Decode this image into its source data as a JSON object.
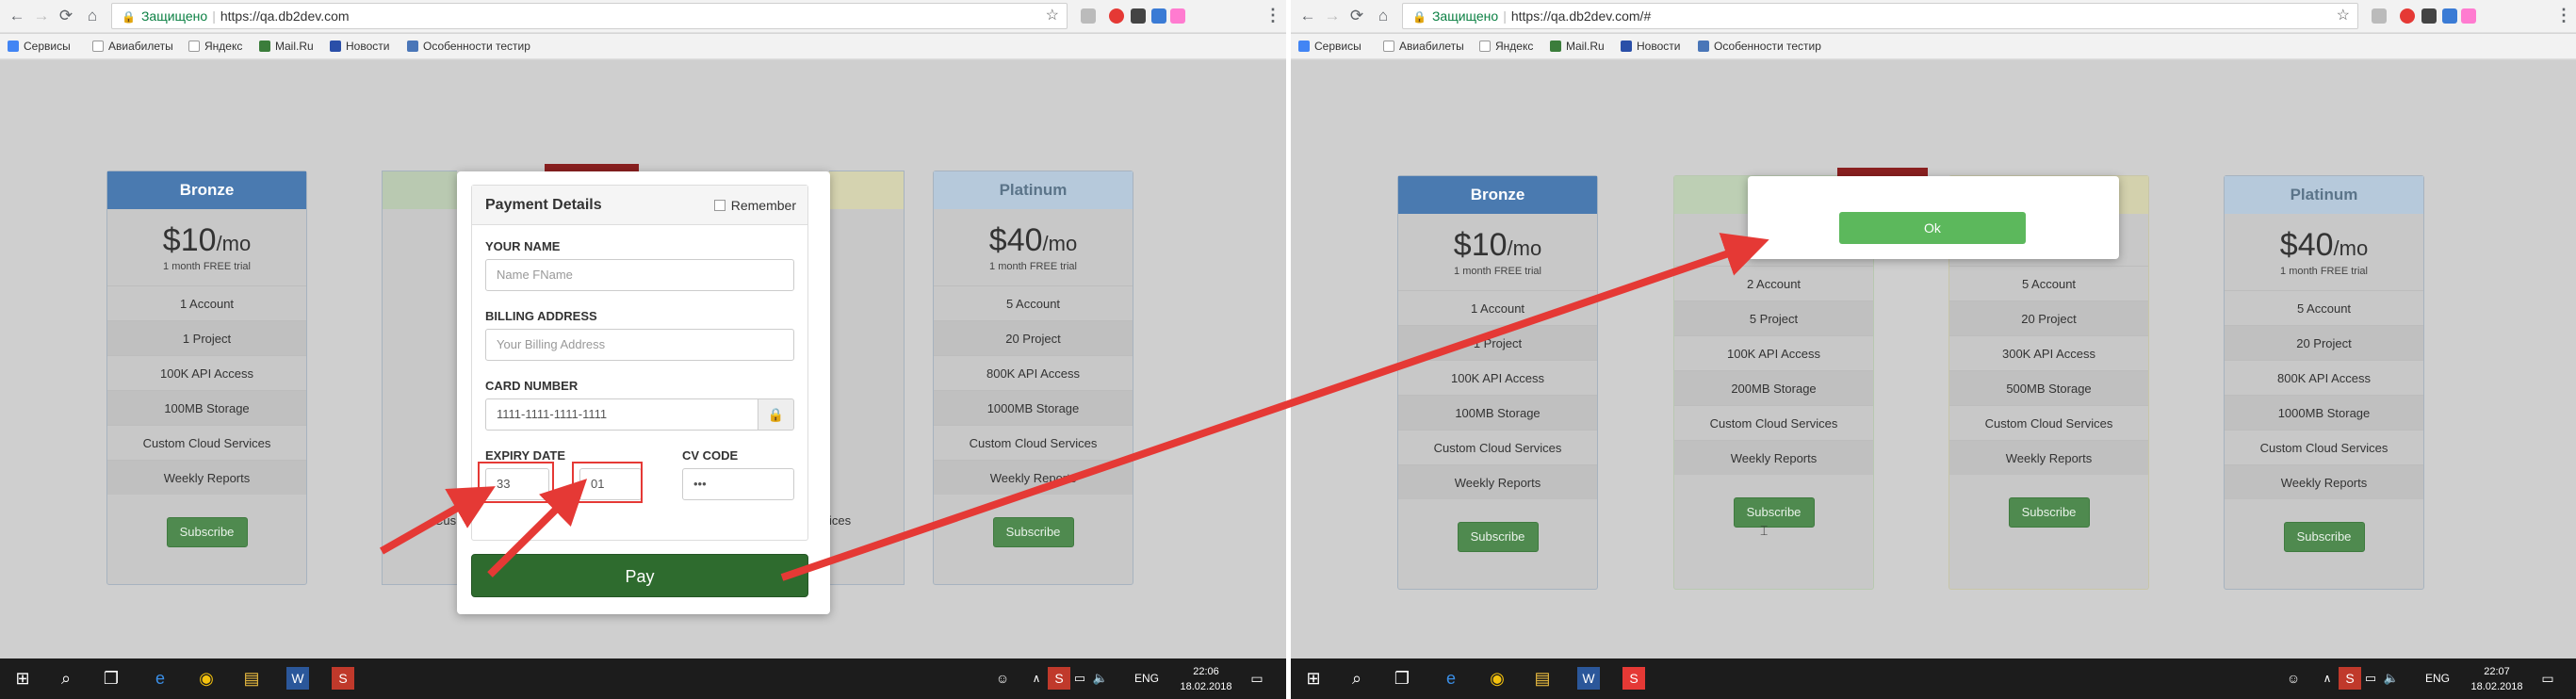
{
  "left": {
    "browser": {
      "secure_label": "Защищено",
      "url": "https://qa.db2dev.com"
    },
    "bookmarks": [
      "Сервисы",
      "Авиабилеты",
      "Яндекс",
      "Mail.Ru",
      "Новости",
      "Особенности тестир"
    ],
    "cards": [
      {
        "name": "Bronze",
        "price": "$10",
        "per": "/mo",
        "trial": "1 month FREE trial",
        "features": [
          "1 Account",
          "1 Project",
          "100K API Access",
          "100MB Storage",
          "Custom Cloud Services",
          "Weekly Reports"
        ],
        "button": "Subscribe"
      },
      {
        "name": "Platinum",
        "price": "$40",
        "per": "/mo",
        "trial": "1 month FREE trial",
        "features": [
          "5 Account",
          "20 Project",
          "800K API Access",
          "1000MB Storage",
          "Custom Cloud Services",
          "Weekly Reports"
        ],
        "button": "Subscribe"
      }
    ],
    "partial_texts": {
      "custom_left": "Cus",
      "custom_right": "ices",
      "weekly_right": "Weekly Reports"
    },
    "modal": {
      "title": "Payment Details",
      "remember": "Remember",
      "name_label": "YOUR NAME",
      "name_placeholder": "Name FName",
      "billing_label": "BILLING ADDRESS",
      "billing_placeholder": "Your Billing Address",
      "card_label": "CARD NUMBER",
      "card_value": "1111-1111-1111-1111",
      "expiry_label": "EXPIRY DATE",
      "expiry_month": "33",
      "expiry_year": "01",
      "cv_label": "CV CODE",
      "cv_value": "•••",
      "pay": "Pay"
    },
    "taskbar": {
      "lang": "ENG",
      "time": "22:06",
      "date": "18.02.2018"
    }
  },
  "right": {
    "browser": {
      "secure_label": "Защищено",
      "url": "https://qa.db2dev.com/#"
    },
    "bookmarks": [
      "Сервисы",
      "Авиабилеты",
      "Яндекс",
      "Mail.Ru",
      "Новости",
      "Особенности тестир"
    ],
    "cards": [
      {
        "name": "Bronze",
        "price": "$10",
        "per": "/mo",
        "trial": "1 month FREE trial",
        "features": [
          "1 Account",
          "1 Project",
          "100K API Access",
          "100MB Storage",
          "Custom Cloud Services",
          "Weekly Reports"
        ],
        "button": "Subscribe"
      },
      {
        "name": "",
        "price": "",
        "per": "",
        "trial": "",
        "features": [
          "2 Account",
          "5 Project",
          "100K API Access",
          "200MB Storage",
          "Custom Cloud Services",
          "Weekly Reports"
        ],
        "button": "Subscribe"
      },
      {
        "name": "",
        "price": "",
        "per": "",
        "trial": "",
        "features": [
          "5 Account",
          "20 Project",
          "300K API Access",
          "500MB Storage",
          "Custom Cloud Services",
          "Weekly Reports"
        ],
        "button": "Subscribe"
      },
      {
        "name": "Platinum",
        "price": "$40",
        "per": "/mo",
        "trial": "1 month FREE trial",
        "features": [
          "5 Account",
          "20 Project",
          "800K API Access",
          "1000MB Storage",
          "Custom Cloud Services",
          "Weekly Reports"
        ],
        "button": "Subscribe"
      }
    ],
    "dialog": {
      "ok": "Ok"
    },
    "taskbar": {
      "lang": "ENG",
      "time": "22:07",
      "date": "18.02.2018"
    }
  },
  "colors": {
    "arrow": "#e53935",
    "pay": "#2e6b2e",
    "ok": "#5cb85c",
    "card_head": "#4a7ab0"
  }
}
